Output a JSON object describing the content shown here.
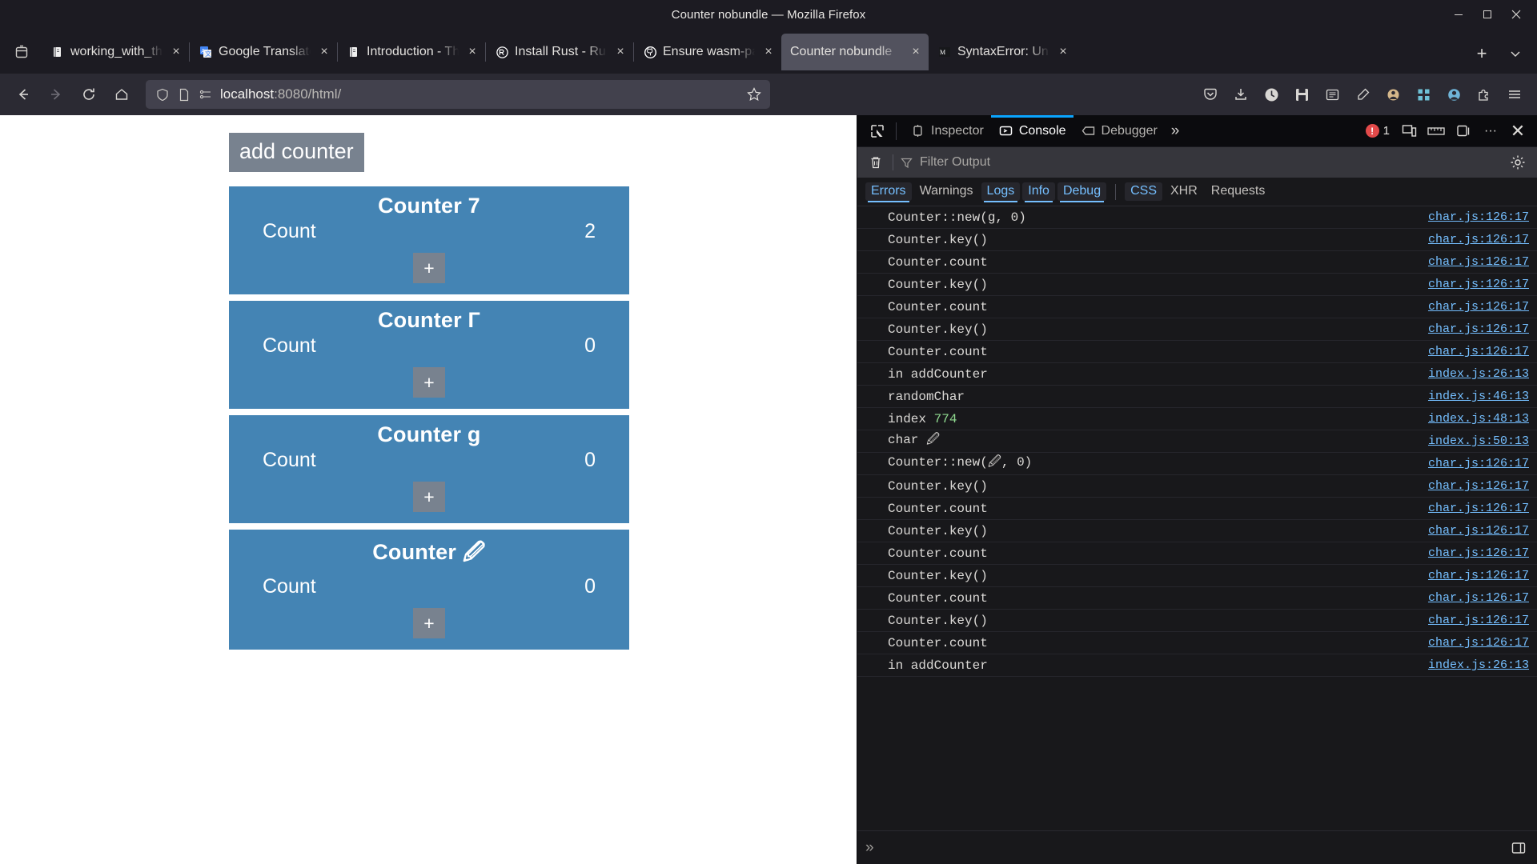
{
  "window": {
    "title": "Counter nobundle — Mozilla Firefox",
    "minimize": "−",
    "maximize": "□",
    "close": "×"
  },
  "tabstrip": {
    "list_all_tabs_label": "⌄",
    "new_tab_label": "+",
    "tabs": [
      {
        "title": "working_with_th",
        "favicon": "book-icon",
        "close": "×",
        "active": false
      },
      {
        "title": "Google Translate",
        "favicon": "google-translate-icon",
        "close": "×",
        "active": false
      },
      {
        "title": "Introduction - Th",
        "favicon": "book-icon",
        "close": "×",
        "active": false
      },
      {
        "title": "Install Rust - Rust",
        "favicon": "rust-icon",
        "close": "×",
        "active": false
      },
      {
        "title": "Ensure wasm-pac",
        "favicon": "github-icon",
        "close": "×",
        "active": false
      },
      {
        "title": "Counter nobundle",
        "favicon": "none",
        "close": "×",
        "active": true
      },
      {
        "title": "SyntaxError: Une",
        "favicon": "mdn-icon",
        "close": "×",
        "active": false
      }
    ]
  },
  "navbar": {
    "back": "←",
    "forward": "→",
    "reload": "⟳",
    "home": "⌂",
    "url_host": "localhost",
    "url_path": ":8080/html/",
    "url_full": "localhost:8080/html/",
    "bookmark_star": "☆",
    "icons": [
      "pocket-icon",
      "downloads-icon",
      "history-icon",
      "save-icon",
      "reader-icon",
      "highlighter-icon",
      "container-icon",
      "extension-grid-icon",
      "account-icon",
      "addons-icon",
      "menu-icon"
    ]
  },
  "page": {
    "add_counter_label": "add counter",
    "counters": [
      {
        "title": "Counter 7",
        "label": "Count",
        "value": "2",
        "increment": "+"
      },
      {
        "title": "Counter Г",
        "label": "Count",
        "value": "0",
        "increment": "+"
      },
      {
        "title": "Counter g",
        "label": "Count",
        "value": "0",
        "increment": "+"
      },
      {
        "title": "Counter 🖉",
        "label": "Count",
        "value": "0",
        "increment": "+"
      }
    ],
    "colors": {
      "card": "#4484b4",
      "button": "#78828f",
      "text": "#ffffff"
    }
  },
  "devtools": {
    "picker_icon": "element-picker-icon",
    "tabs": [
      {
        "label": "Inspector",
        "icon": "inspector-icon",
        "active": false
      },
      {
        "label": "Console",
        "icon": "console-icon",
        "active": true
      },
      {
        "label": "Debugger",
        "icon": "debugger-icon",
        "active": false
      }
    ],
    "more_tabs": "»",
    "error_count": "1",
    "right_icons": [
      "responsive-design-icon",
      "ruler-icon",
      "separate-window-icon",
      "meatball-menu-icon",
      "close-icon"
    ],
    "meatball": "···",
    "close": "✕",
    "filterbar": {
      "clear_icon": "trash-icon",
      "filter_icon": "funnel-icon",
      "placeholder": "Filter Output",
      "settings_icon": "gear-icon"
    },
    "filters": [
      {
        "label": "Errors",
        "on": true
      },
      {
        "label": "Warnings",
        "on": false
      },
      {
        "label": "Logs",
        "on": true
      },
      {
        "label": "Info",
        "on": true
      },
      {
        "label": "Debug",
        "on": true
      },
      {
        "label": "CSS",
        "on": true
      },
      {
        "label": "XHR",
        "on": false
      },
      {
        "label": "Requests",
        "on": false
      }
    ],
    "rows": [
      {
        "msg": "Counter::new(g, 0)",
        "src": "char.js:126:17"
      },
      {
        "msg": "Counter.key()",
        "src": "char.js:126:17"
      },
      {
        "msg": "Counter.count",
        "src": "char.js:126:17"
      },
      {
        "msg": "Counter.key()",
        "src": "char.js:126:17"
      },
      {
        "msg": "Counter.count",
        "src": "char.js:126:17"
      },
      {
        "msg": "Counter.key()",
        "src": "char.js:126:17"
      },
      {
        "msg": "Counter.count",
        "src": "char.js:126:17"
      },
      {
        "msg": "in addCounter",
        "src": "index.js:26:13"
      },
      {
        "msg": "randomChar",
        "src": "index.js:46:13"
      },
      {
        "msg": "index ",
        "num": "774",
        "src": "index.js:48:13"
      },
      {
        "msg": "char 🖉",
        "src": "index.js:50:13"
      },
      {
        "msg": "Counter::new(🖉, 0)",
        "src": "char.js:126:17"
      },
      {
        "msg": "Counter.key()",
        "src": "char.js:126:17"
      },
      {
        "msg": "Counter.count",
        "src": "char.js:126:17"
      },
      {
        "msg": "Counter.key()",
        "src": "char.js:126:17"
      },
      {
        "msg": "Counter.count",
        "src": "char.js:126:17"
      },
      {
        "msg": "Counter.key()",
        "src": "char.js:126:17"
      },
      {
        "msg": "Counter.count",
        "src": "char.js:126:17"
      },
      {
        "msg": "Counter.key()",
        "src": "char.js:126:17"
      },
      {
        "msg": "Counter.count",
        "src": "char.js:126:17"
      },
      {
        "msg": "in addCounter",
        "src": "index.js:26:13"
      }
    ],
    "prompt": "»",
    "split_console_icon": "split-console-icon"
  }
}
